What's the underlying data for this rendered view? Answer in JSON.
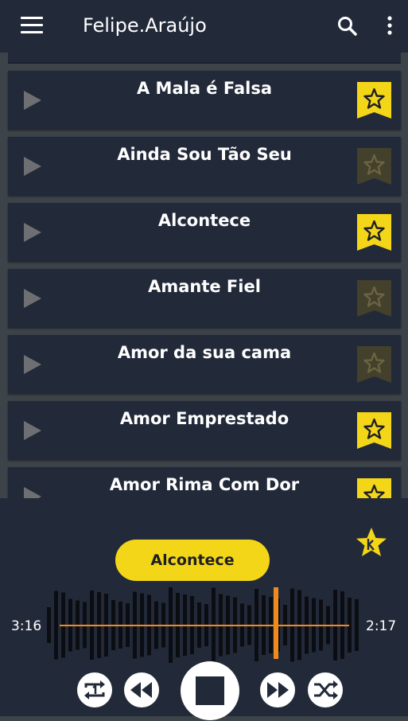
{
  "app": {
    "title": "Felipe.Araújo",
    "menu_icon": "hamburger-menu-icon",
    "search_icon": "search-icon",
    "more_icon": "more-vert-icon"
  },
  "songs": [
    {
      "title": "A Mala é Falsa",
      "favorite": true
    },
    {
      "title": "Ainda Sou Tão Seu",
      "favorite": false
    },
    {
      "title": "Alcontece",
      "favorite": true
    },
    {
      "title": "Amante Fiel",
      "favorite": false
    },
    {
      "title": "Amor da sua cama",
      "favorite": false
    },
    {
      "title": "Amor Emprestado",
      "favorite": true
    },
    {
      "title": "Amor Rima Com Dor",
      "favorite": true
    }
  ],
  "player": {
    "now_playing": "Alcontece",
    "elapsed": "3:16",
    "remaining": "2:17",
    "progress_fraction": 0.68,
    "controls": [
      "repeat-one-icon",
      "rewind-icon",
      "stop-icon",
      "fast-forward-icon",
      "shuffle-icon"
    ]
  },
  "colors": {
    "accent_yellow": "#f4d619",
    "favorite_off": "#43402c",
    "progress_orange": "#f08a1c",
    "card_bg": "#222a3a",
    "page_bg": "#3c4349"
  }
}
